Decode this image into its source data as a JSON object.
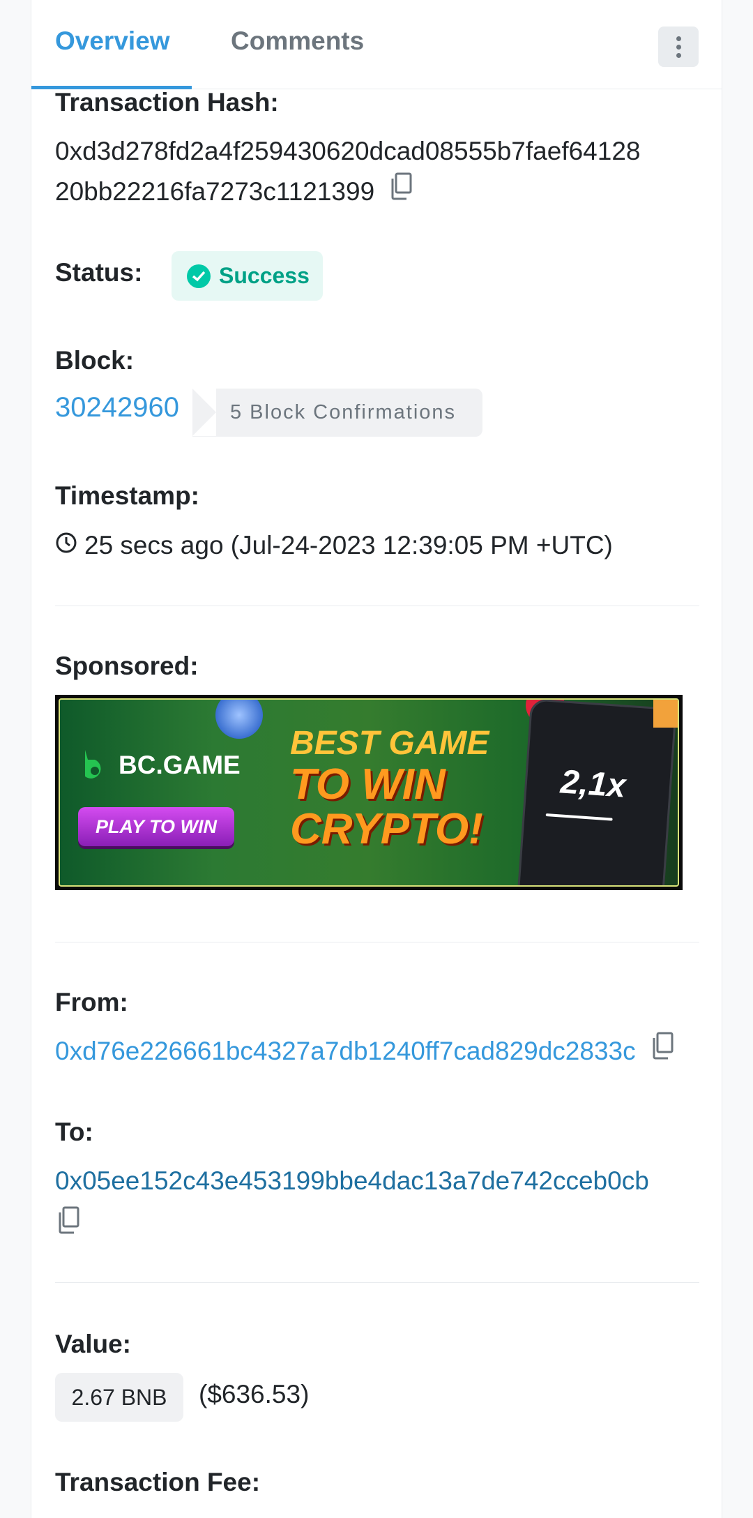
{
  "tabs": {
    "overview": "Overview",
    "comments": "Comments"
  },
  "tx": {
    "hash_label": "Transaction Hash:",
    "hash_line1": "0xd3d278fd2a4f259430620dcad08555b7faef64128",
    "hash_line2": "20bb22216fa7273c1121399",
    "status_label": "Status:",
    "status_value": "Success",
    "block_label": "Block:",
    "block_number": "30242960",
    "block_confirmations": "5 Block Confirmations",
    "timestamp_label": "Timestamp:",
    "timestamp_value": "25 secs ago (Jul-24-2023 12:39:05 PM +UTC)",
    "sponsored_label": "Sponsored:",
    "from_label": "From:",
    "from_address": "0xd76e226661bc4327a7db1240ff7cad829dc2833c",
    "to_label": "To:",
    "to_address": "0x05ee152c43e453199bbe4dac13a7de742cceb0cb",
    "value_label": "Value:",
    "value_amount": "2.67 BNB",
    "value_usd": "($636.53)",
    "fee_label": "Transaction Fee:"
  },
  "ad": {
    "brand": "BC.GAME",
    "play_button": "PLAY TO WIN",
    "headline_1": "BEST GAME",
    "headline_2a": "TO WIN",
    "headline_2b": "CRYPTO!",
    "multiplier": "2,1x"
  },
  "colors": {
    "accent": "#3598dc",
    "success": "#00a186",
    "success_bg": "#e6f8f4"
  }
}
